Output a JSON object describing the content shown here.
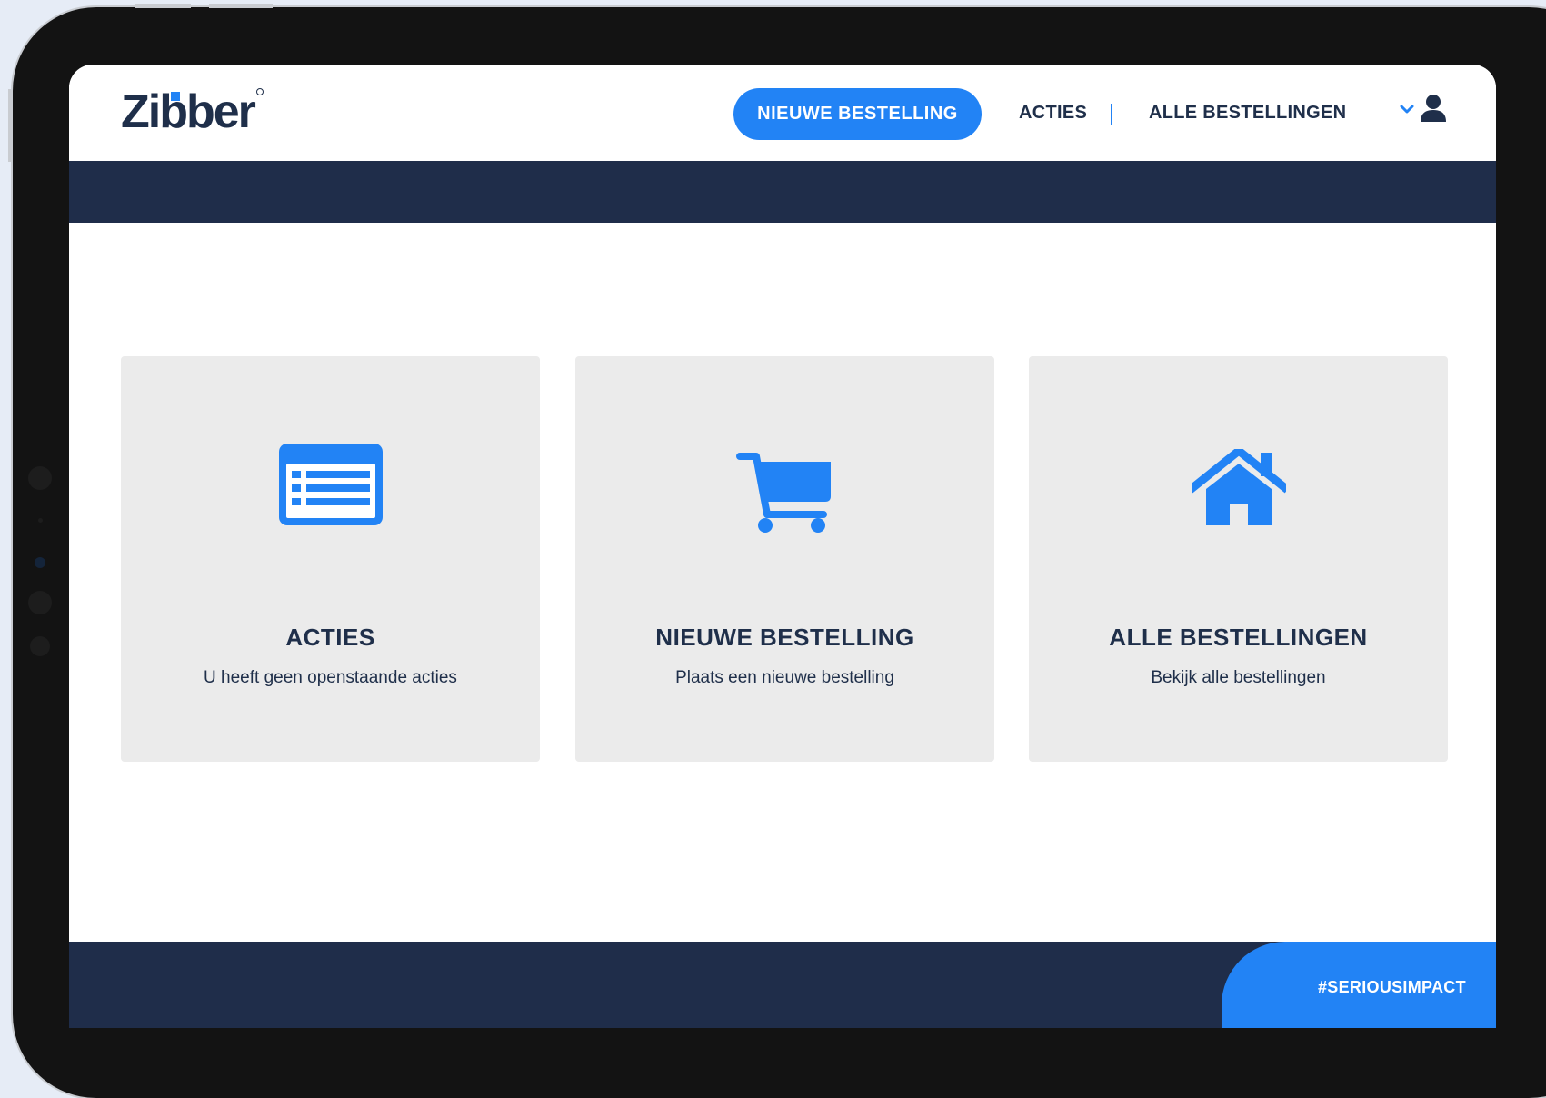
{
  "brand": {
    "logo_text": "Zibber",
    "accent_color": "#2283f5",
    "navy_color": "#1f2d4a"
  },
  "nav": {
    "cta_label": "NIEUWE BESTELLING",
    "acties_label": "ACTIES",
    "alle_bestellingen_label": "ALLE BESTELLINGEN",
    "user_icon": "user-icon",
    "dropdown_icon": "chevron-down-icon"
  },
  "cards": [
    {
      "title": "ACTIES",
      "subtitle": "U heeft geen openstaande acties",
      "icon": "list-icon"
    },
    {
      "title": "NIEUWE BESTELLING",
      "subtitle": "Plaats een nieuwe bestelling",
      "icon": "cart-icon"
    },
    {
      "title": "ALLE BESTELLINGEN",
      "subtitle": "Bekijk alle bestellingen",
      "icon": "home-icon"
    }
  ],
  "footer": {
    "hashtag": "#SERIOUSIMPACT"
  }
}
